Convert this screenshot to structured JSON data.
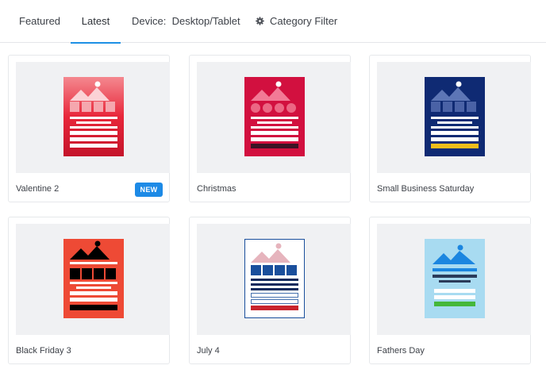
{
  "tabs": [
    {
      "label": "Featured",
      "active": false
    },
    {
      "label": "Latest",
      "active": true
    },
    {
      "label": "Device:  Desktop/Tablet",
      "active": false
    },
    {
      "label": "Category Filter",
      "active": false,
      "icon": "gear-icon"
    }
  ],
  "templates": [
    {
      "title": "Valentine 2",
      "badge": "NEW",
      "accent": "#e8273a"
    },
    {
      "title": "Christmas",
      "accent": "#d2103f"
    },
    {
      "title": "Small Business Saturday",
      "accent": "#0f2a73"
    },
    {
      "title": "Black Friday 3",
      "accent": "#ee4a35"
    },
    {
      "title": "July 4",
      "accent": "#1a4f9c"
    },
    {
      "title": "Fathers Day",
      "accent": "#a8dbf1"
    }
  ],
  "colors": {
    "active_tab_underline": "#1e90e5",
    "badge": "#1d8ae6"
  }
}
